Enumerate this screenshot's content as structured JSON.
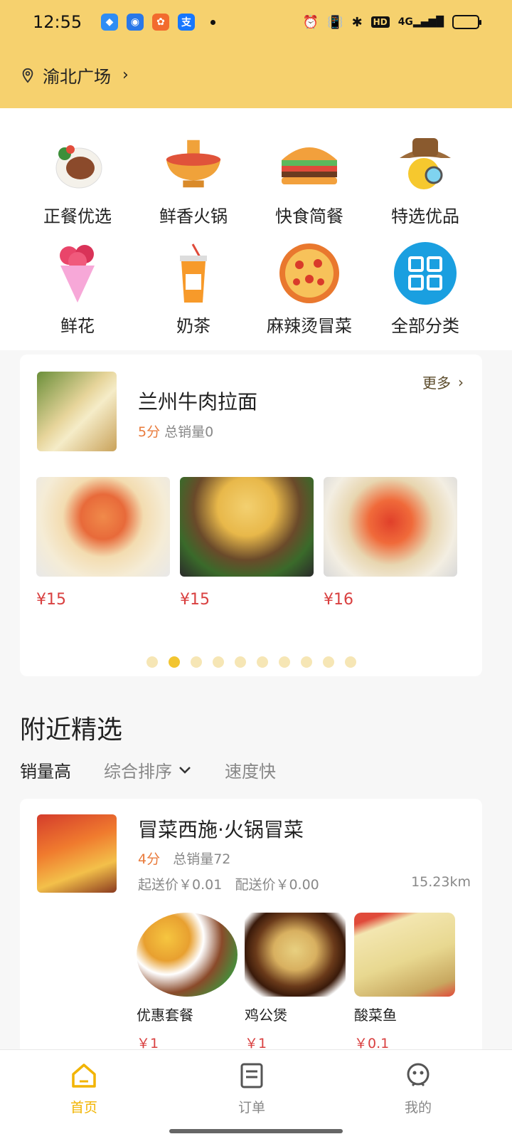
{
  "status_bar": {
    "time": "12:55",
    "network": "4G",
    "hd": "HD"
  },
  "header": {
    "location": "渝北广场"
  },
  "categories": [
    {
      "label": "正餐优选",
      "icon": "steak-plate-icon"
    },
    {
      "label": "鲜香火锅",
      "icon": "hotpot-icon"
    },
    {
      "label": "快食简餐",
      "icon": "burger-icon"
    },
    {
      "label": "特选优品",
      "icon": "detective-icon"
    },
    {
      "label": "鲜花",
      "icon": "flower-bouquet-icon"
    },
    {
      "label": "奶茶",
      "icon": "milk-tea-icon"
    },
    {
      "label": "麻辣烫冒菜",
      "icon": "pizza-icon"
    },
    {
      "label": "全部分类",
      "icon": "grid-icon"
    }
  ],
  "featured": {
    "shop_name": "兰州牛肉拉面",
    "score": "5分",
    "sales": "总销量0",
    "more_label": "更多",
    "dishes": [
      {
        "price": "¥15"
      },
      {
        "price": "¥15"
      },
      {
        "price": "¥16"
      }
    ],
    "page_count": 10,
    "active_page": 2
  },
  "nearby": {
    "title": "附近精选",
    "sort": {
      "sales_high": "销量高",
      "overall": "综合排序",
      "fast": "速度快"
    },
    "shop": {
      "name": "冒菜西施·火锅冒菜",
      "score": "4分",
      "sales": "总销量72",
      "min_order": "起送价￥0.01",
      "delivery_fee": "配送价￥0.00",
      "distance": "15.23km",
      "items": [
        {
          "name": "优惠套餐",
          "price": "￥1"
        },
        {
          "name": "鸡公煲",
          "price": "￥1"
        },
        {
          "name": "酸菜鱼",
          "price": "￥0.1"
        }
      ]
    }
  },
  "bottom_nav": {
    "home": "首页",
    "orders": "订单",
    "mine": "我的"
  },
  "colors": {
    "header_bg": "#f6d16e",
    "accent": "#f2b400",
    "price": "#d94040",
    "score": "#e97b3c"
  }
}
